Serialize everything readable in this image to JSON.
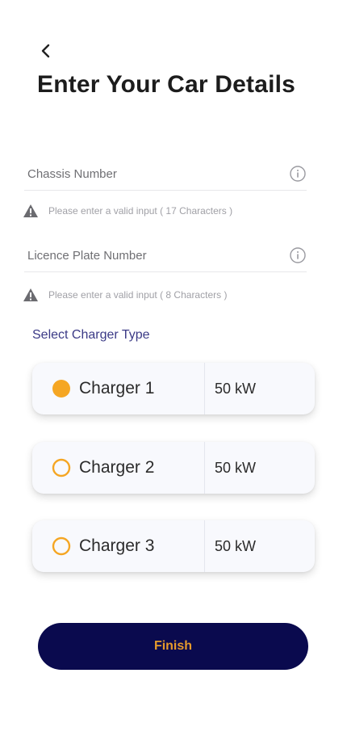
{
  "header": {
    "back_icon": "chevron-left-icon",
    "title": "Enter Your Car Details"
  },
  "form": {
    "chassis": {
      "placeholder": "Chassis Number",
      "value": "",
      "hint": "Please enter a valid input ( 17 Characters )",
      "hint_icon": "warning-icon",
      "info_icon": "info-icon"
    },
    "license_plate": {
      "placeholder": "Licence Plate Number",
      "value": "",
      "hint": "Please enter a valid input ( 8 Characters )",
      "hint_icon": "warning-icon",
      "info_icon": "info-icon"
    }
  },
  "charger_section": {
    "label": "Select Charger Type",
    "options": [
      {
        "name": "Charger 1",
        "power": "50 kW",
        "selected": true
      },
      {
        "name": "Charger 2",
        "power": "50 kW",
        "selected": false
      },
      {
        "name": "Charger 3",
        "power": "50 kW",
        "selected": false
      }
    ]
  },
  "finish_button": {
    "label": "Finish"
  },
  "colors": {
    "primary_navy": "#0a0a4e",
    "accent_orange": "#f5a623",
    "section_label": "#3b3a86"
  }
}
